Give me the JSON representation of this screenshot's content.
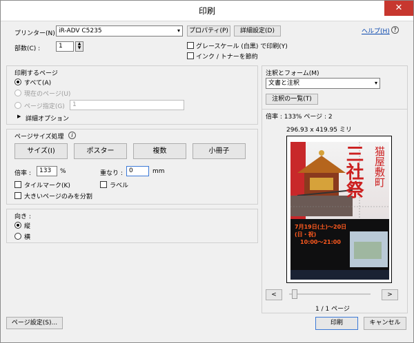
{
  "window": {
    "title": "印刷",
    "close": "✕"
  },
  "printer": {
    "label": "プリンター(N) :",
    "value": "iR-ADV C5235",
    "properties": "プロパティ(P)",
    "advanced": "詳細設定(D)"
  },
  "help": {
    "label": "ヘルプ(H)",
    "icon": "?"
  },
  "copies": {
    "label": "部数(C) :",
    "value": "1"
  },
  "options": {
    "grayscale": "グレースケール (白黒) で印刷(Y)",
    "save_ink": "インク / トナーを節約"
  },
  "pages": {
    "heading": "印刷するページ",
    "all": "すべて(A)",
    "current": "現在のページ(U)",
    "range": "ページ指定(G)",
    "range_value": "1",
    "more": "詳細オプション"
  },
  "sizing": {
    "heading": "ページサイズ処理",
    "info_icon": "i",
    "tabs": [
      "サイズ(I)",
      "ポスター",
      "複数",
      "小冊子"
    ],
    "scale_label": "倍率 :",
    "scale_value": "133",
    "scale_unit": "%",
    "overlap_label": "重なり :",
    "overlap_value": "0",
    "overlap_unit": "mm",
    "tile_marks": "タイルマーク(K)",
    "labels": "ラベル",
    "split_large": "大きいページのみを分割"
  },
  "orientation": {
    "heading": "向き :",
    "portrait": "縦",
    "landscape": "横"
  },
  "comments": {
    "heading": "注釈とフォーム(M)",
    "value": "文書と注釈",
    "summary": "注釈の一覧(T)"
  },
  "preview": {
    "info": "倍率 : 133% ページ : 2",
    "size": "296.93 x 419.95 ミリ",
    "prev": "<",
    "next": ">",
    "page_count": "1 / 1 ページ"
  },
  "poster_text": {
    "title": "三社祭",
    "subtitle": "猫屋敷町",
    "date": "7月19日(土)〜20日(日・祝)",
    "time": "10:00〜21:00"
  },
  "footer": {
    "page_setup": "ページ設定(S)...",
    "print": "印刷",
    "cancel": "キャンセル"
  }
}
